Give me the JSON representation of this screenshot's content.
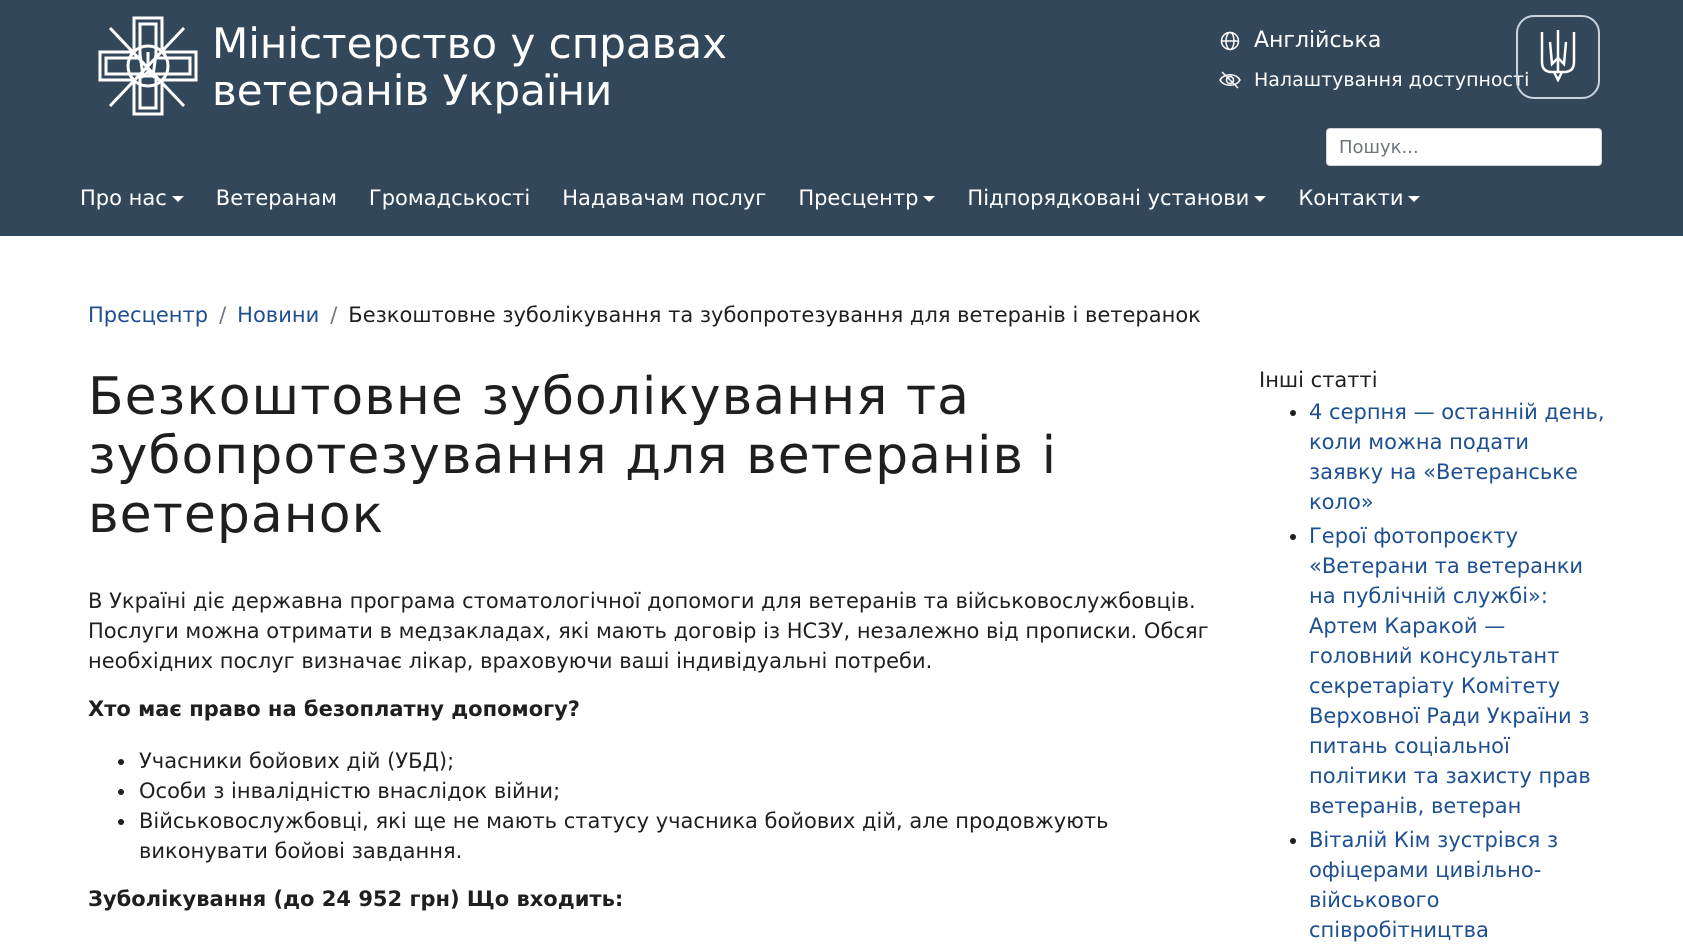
{
  "header": {
    "site_title_line1": "Міністерство у справах",
    "site_title_line2": "ветеранів України",
    "language_label": "Англійська",
    "accessibility_label": "Налаштування доступності",
    "search_placeholder": "Пошук...",
    "colors": {
      "background": "#33475b",
      "text": "#ffffff"
    }
  },
  "nav": {
    "items": [
      {
        "label": "Про нас"
      },
      {
        "label": "Ветеранам"
      },
      {
        "label": "Громадськості"
      },
      {
        "label": "Надавачам послуг"
      },
      {
        "label": "Пресцентр"
      },
      {
        "label": "Підпорядковані установи"
      },
      {
        "label": "Контакти"
      }
    ]
  },
  "breadcrumb": {
    "items": [
      "Пресцентр",
      "Новини"
    ],
    "current": "Безкоштовне зуболікування та зубопротезування для ветеранів і ветеранок"
  },
  "article": {
    "title": "Безкоштовне зуболікування та зубопротезування для ветеранів і ветеранок",
    "intro": "В Україні діє державна програма стоматологічної допомоги для ветеранів та військовослужбовців. Послуги можна отримати в медзакладах, які мають договір із НСЗУ, незалежно від прописки. Обсяг необхідних послуг визначає лікар, враховуючи ваші індивідуальні потреби.",
    "question1": "Хто має право на безоплатну допомогу?",
    "eligibility": [
      "Учасники бойових дій (УБД);",
      "Особи з інвалідністю внаслідок війни;",
      "Військовослужбовці, які ще не мають статусу учасника бойових дій, але продовжують виконувати бойові завдання."
    ],
    "question2": "Зуболікування (до 24 952 грн) Що входить:"
  },
  "sidebar": {
    "title": "Інші статті",
    "articles": [
      "4 серпня — останній день, коли можна подати заявку на «Ветеранське коло»",
      "Герої фотопроєкту «Ветерани та ветеранки на публічній службі»: Артем Каракой — головний консультант секретаріату Комітету Верховної Ради України з питань соціальної політики та захисту прав ветеранів, ветеран",
      "Віталій Кім зустрівся з офіцерами цивільно-військового співробітництва"
    ],
    "link_color": "#1d4f91"
  }
}
